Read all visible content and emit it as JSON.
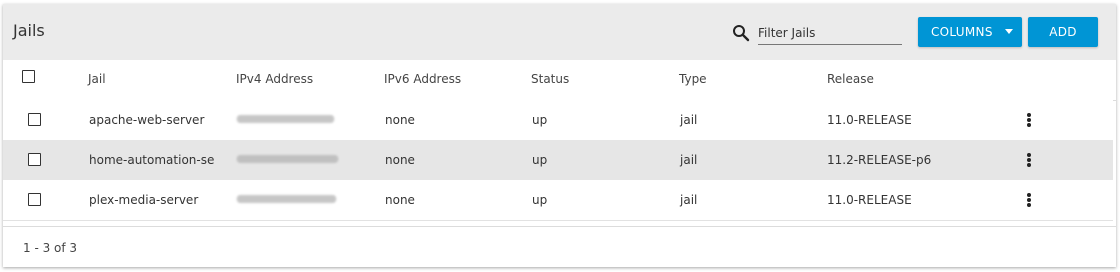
{
  "toolbar": {
    "title": "Jails",
    "search_icon": "search-icon",
    "filter_placeholder": "Filter Jails",
    "columns_label": "COLUMNS",
    "add_label": "ADD",
    "accent_color": "#0095d5"
  },
  "table": {
    "columns": [
      "Jail",
      "IPv4 Address",
      "IPv6 Address",
      "Status",
      "Type",
      "Release"
    ],
    "rows": [
      {
        "jail": "apache-web-server",
        "ipv4": "",
        "ipv6": "none",
        "status": "up",
        "type": "jail",
        "release": "11.0-RELEASE"
      },
      {
        "jail": "home-automation-se",
        "ipv4": "",
        "ipv6": "none",
        "status": "up",
        "type": "jail",
        "release": "11.2-RELEASE-p6"
      },
      {
        "jail": "plex-media-server",
        "ipv4": "",
        "ipv6": "none",
        "status": "up",
        "type": "jail",
        "release": "11.0-RELEASE"
      }
    ],
    "row_action_icon": "more-vertical-icon"
  },
  "footer": {
    "range_text": "1 - 3 of 3"
  }
}
